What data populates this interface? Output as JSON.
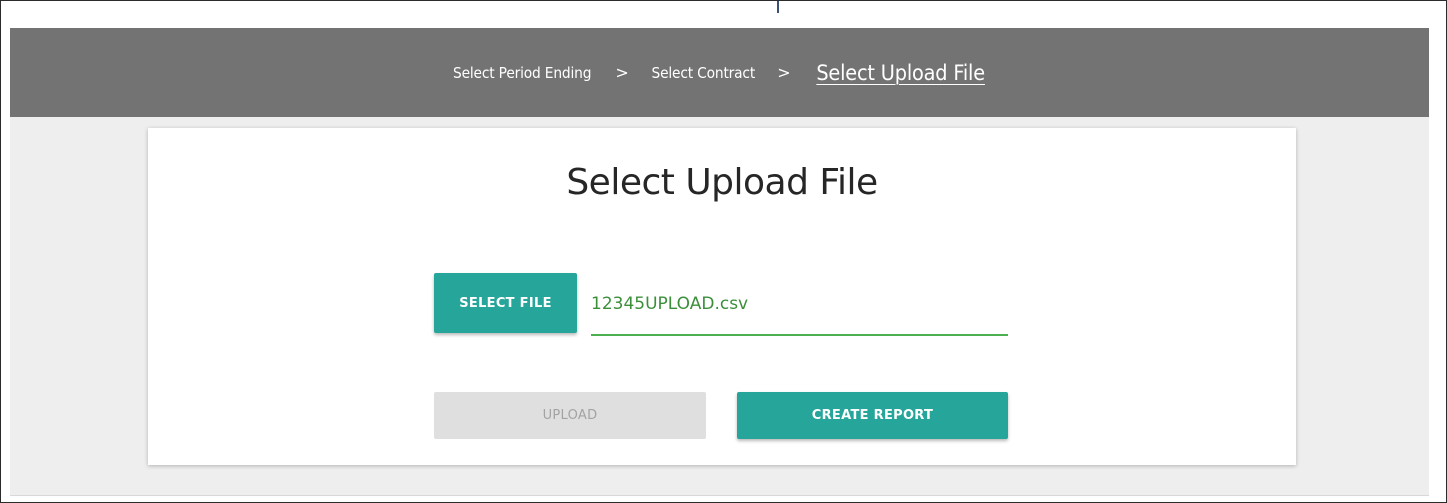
{
  "breadcrumb": {
    "items": [
      {
        "label": "Select Period Ending",
        "active": false
      },
      {
        "label": "Select Contract",
        "active": false
      },
      {
        "label": "Select Upload File",
        "active": true
      }
    ],
    "separator": ">"
  },
  "card": {
    "title": "Select Upload File",
    "select_file_label": "SELECT FILE",
    "file_name": "12345UPLOAD.csv",
    "upload_label": "UPLOAD",
    "create_report_label": "CREATE REPORT"
  },
  "colors": {
    "header_bg": "#737373",
    "page_bg": "#eeeeee",
    "primary": "#26a69a",
    "disabled_bg": "#dfdfdf",
    "disabled_text": "#a3a3a3",
    "file_underline": "#4caf50",
    "file_text": "#3b8f3b"
  },
  "icons": {
    "breadcrumb_separator": "chevron-right-icon"
  }
}
